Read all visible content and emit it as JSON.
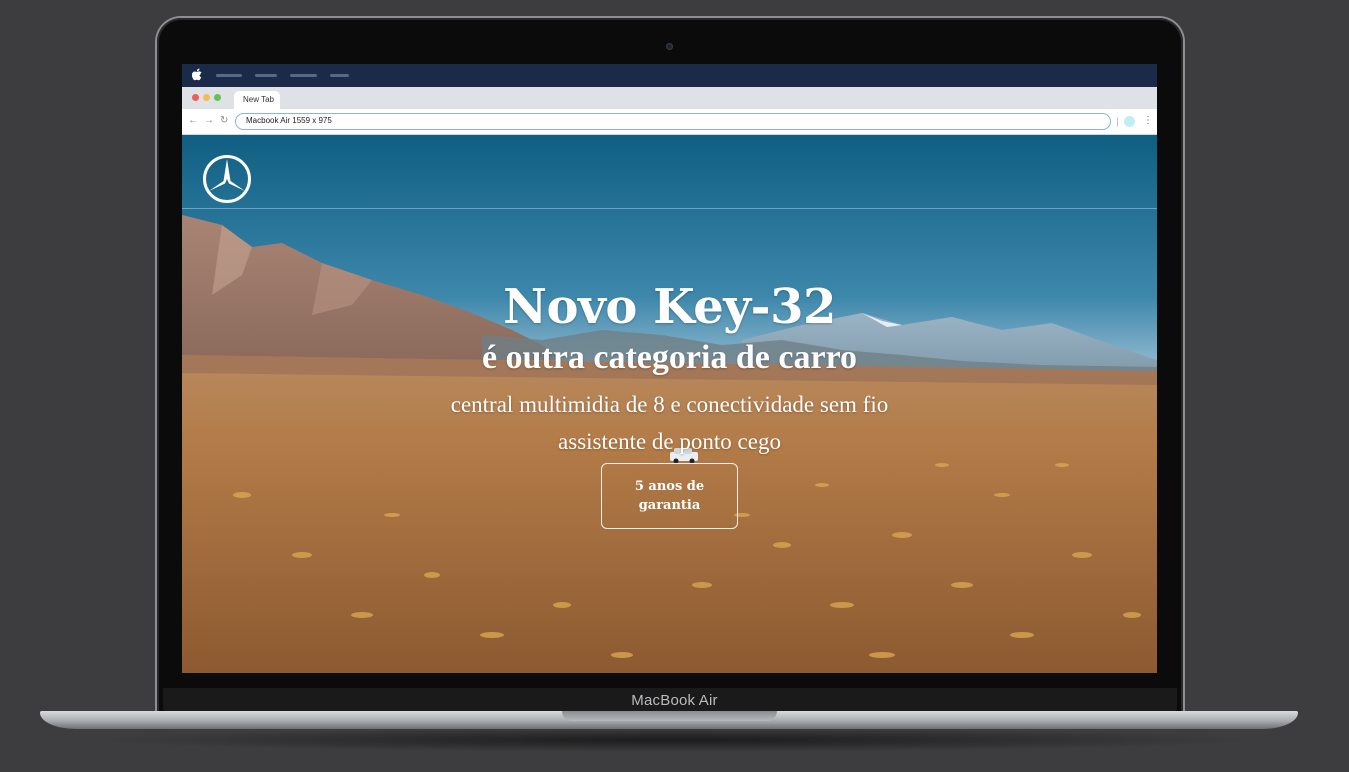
{
  "device": {
    "label": "MacBook Air"
  },
  "browser": {
    "tab_title": "New Tab",
    "address": "Macbook Air   1559 x 975"
  },
  "page": {
    "hero": {
      "title": "Novo Key-32",
      "subtitle": "é outra categoria de carro",
      "features": [
        "central multimidia de 8 e conectividade sem fio",
        "assistente de ponto cego"
      ],
      "cta_label": "5 anos de garantia"
    }
  },
  "icons": [
    "apple-icon",
    "back-icon",
    "forward-icon",
    "reload-icon",
    "profile-icon",
    "menu-dots-icon",
    "star-logo-icon"
  ],
  "colors": {
    "menubar": "#1c2a4a",
    "tabstrip": "#dee1e6",
    "url_border": "#8eb2de",
    "hero_text": "#ffffff"
  }
}
